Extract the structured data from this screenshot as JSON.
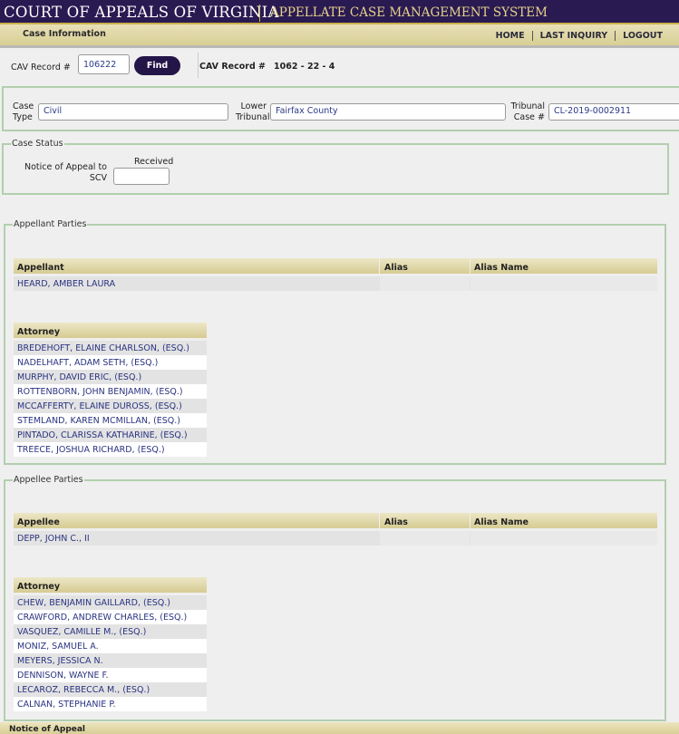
{
  "header": {
    "court_title": "COURT OF APPEALS OF VIRGINIA",
    "system_title": "APPELLATE CASE MANAGEMENT SYSTEM"
  },
  "nav": {
    "section_label": "Case Information",
    "links": [
      "HOME",
      "LAST INQUIRY",
      "LOGOUT"
    ]
  },
  "search": {
    "label": "CAV Record #",
    "value": "106222",
    "find_label": "Find",
    "record_label": "CAV Record #",
    "record_value": "1062 - 22 - 4"
  },
  "case": {
    "case_type_label_1": "Case",
    "case_type_label_2": "Type",
    "case_type": "Civil",
    "lower_tribunal_label_1": "Lower",
    "lower_tribunal_label_2": "Tribunal",
    "lower_tribunal": "Fairfax County",
    "tribunal_case_label_1": "Tribunal",
    "tribunal_case_label_2": "Case #",
    "tribunal_case": "CL-2019-0002911"
  },
  "case_status": {
    "legend": "Case Status",
    "notice_label_1": "Notice of Appeal to",
    "notice_label_2": "SCV",
    "received_label": "Received",
    "received_value": ""
  },
  "appellant": {
    "legend": "Appellant Parties",
    "headers": [
      "Appellant",
      "Alias",
      "Alias Name"
    ],
    "party": "HEARD, AMBER LAURA",
    "attorney_header": "Attorney",
    "attorneys": [
      "BREDEHOFT, ELAINE CHARLSON, (ESQ.)",
      "NADELHAFT, ADAM SETH, (ESQ.)",
      "MURPHY, DAVID ERIC, (ESQ.)",
      "ROTTENBORN, JOHN BENJAMIN, (ESQ.)",
      "MCCAFFERTY, ELAINE DUROSS, (ESQ.)",
      "STEMLAND, KAREN MCMILLAN, (ESQ.)",
      "PINTADO, CLARISSA KATHARINE, (ESQ.)",
      "TREECE, JOSHUA RICHARD, (ESQ.)"
    ]
  },
  "appellee": {
    "legend": "Appellee Parties",
    "headers": [
      "Appellee",
      "Alias",
      "Alias Name"
    ],
    "party": "DEPP, JOHN C., II",
    "attorney_header": "Attorney",
    "attorneys": [
      "CHEW, BENJAMIN GAILLARD, (ESQ.)",
      "CRAWFORD, ANDREW CHARLES, (ESQ.)",
      "VASQUEZ, CAMILLE M., (ESQ.)",
      "MONIZ, SAMUEL A.",
      "MEYERS, JESSICA N.",
      "DENNISON, WAYNE F.",
      "LECAROZ, REBECCA M., (ESQ.)",
      "CALNAN, STEPHANIE P."
    ]
  },
  "bottom": {
    "label": "Notice of Appeal"
  },
  "colors": {
    "header_bg": "#2a1a52",
    "accent_gold": "#c8b14a",
    "link_blue": "#2a3380",
    "box_border": "#b2cfae"
  }
}
